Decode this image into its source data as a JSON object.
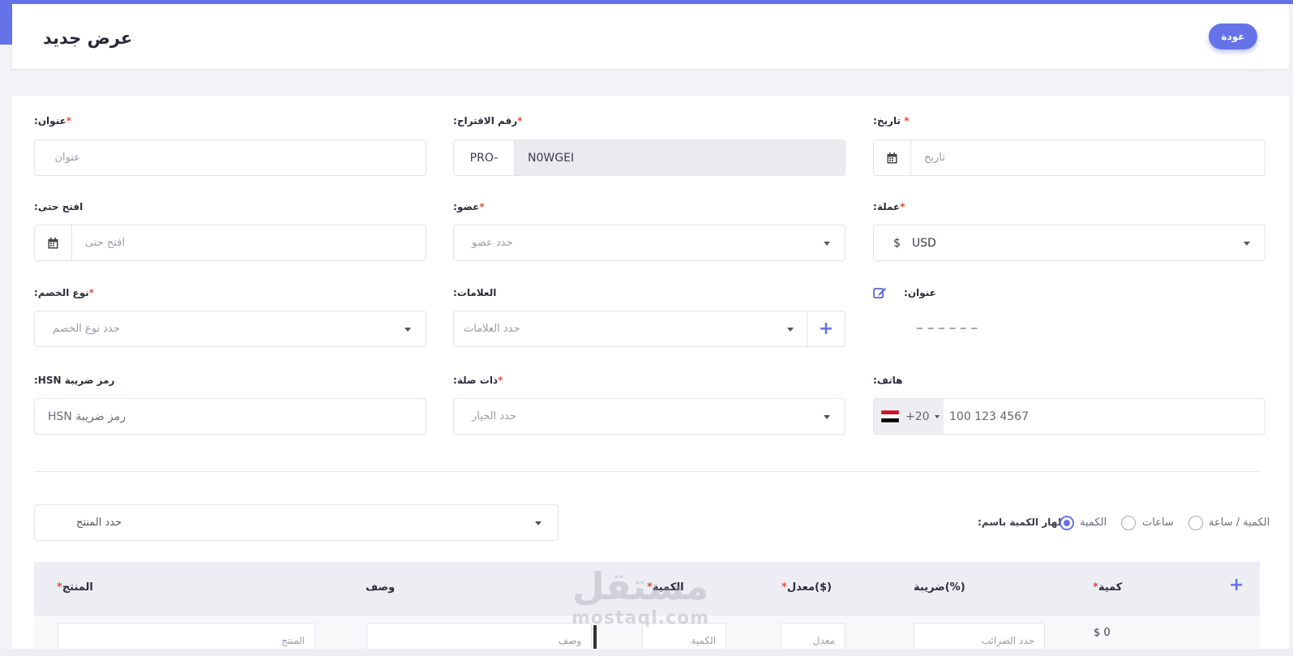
{
  "header": {
    "title": "عرض جديد",
    "back_label": "عودة"
  },
  "fields": {
    "title": {
      "label": ":عنوان",
      "placeholder": "عنوان"
    },
    "proposal_number": {
      "label": ":رقم الاقتراح",
      "prefix": "PRO-",
      "value": "N0WGEI"
    },
    "date": {
      "label": ":تاريخ",
      "placeholder": "تاريخ"
    },
    "open_till": {
      "label": ":افتح حتى",
      "placeholder": "افتح حتى"
    },
    "member": {
      "label": ":عضو",
      "placeholder": "حدد عضو"
    },
    "currency": {
      "label": ":عملة",
      "symbol": "$",
      "value": "USD"
    },
    "discount_type": {
      "label": ":نوع الخصم",
      "placeholder": "حدد نوع الخصم"
    },
    "tags": {
      "label": ":العلامات",
      "placeholder": "حدد العلامات",
      "add": "+"
    },
    "address": {
      "label": ":عنوان",
      "value": "_ _ _ _ _ _"
    },
    "hsn": {
      "label": ":HSN رمز ضريبة",
      "placeholder": "HSN رمز ضريبة"
    },
    "related": {
      "label": ":ذات صلة",
      "placeholder": "حدد الخيار"
    },
    "phone": {
      "label": ":هاتف",
      "code": "+20",
      "placeholder": "100 123 4567"
    }
  },
  "required_mark": "*",
  "product_select": {
    "placeholder": "حدد المنتج"
  },
  "quantity_display": {
    "label": ":إظهار الكمية باسم",
    "options": [
      "الكمية",
      "ساعات",
      "الكمية / ساعة"
    ],
    "selected": "الكمية"
  },
  "table": {
    "headers": {
      "product": "المنتج",
      "description": "وصف",
      "quantity": "الكمية",
      "rate": "معدل($)",
      "tax": "ضريبة(%)",
      "amount": "كمية",
      "add": "+"
    },
    "row": {
      "product": "المنتج",
      "description": "وصف",
      "quantity": "الكمية",
      "rate": "معدل",
      "tax": "حدد الضرائب",
      "amount": "$ 0"
    }
  },
  "watermark": {
    "arabic": "مستقل",
    "latin": "mostaql.com"
  },
  "colors": {
    "accent": "#6673e8",
    "required": "#e74c3c"
  },
  "icons": {
    "calendar": "calendar-icon",
    "edit": "edit-icon",
    "flag": "egypt-flag-icon"
  }
}
